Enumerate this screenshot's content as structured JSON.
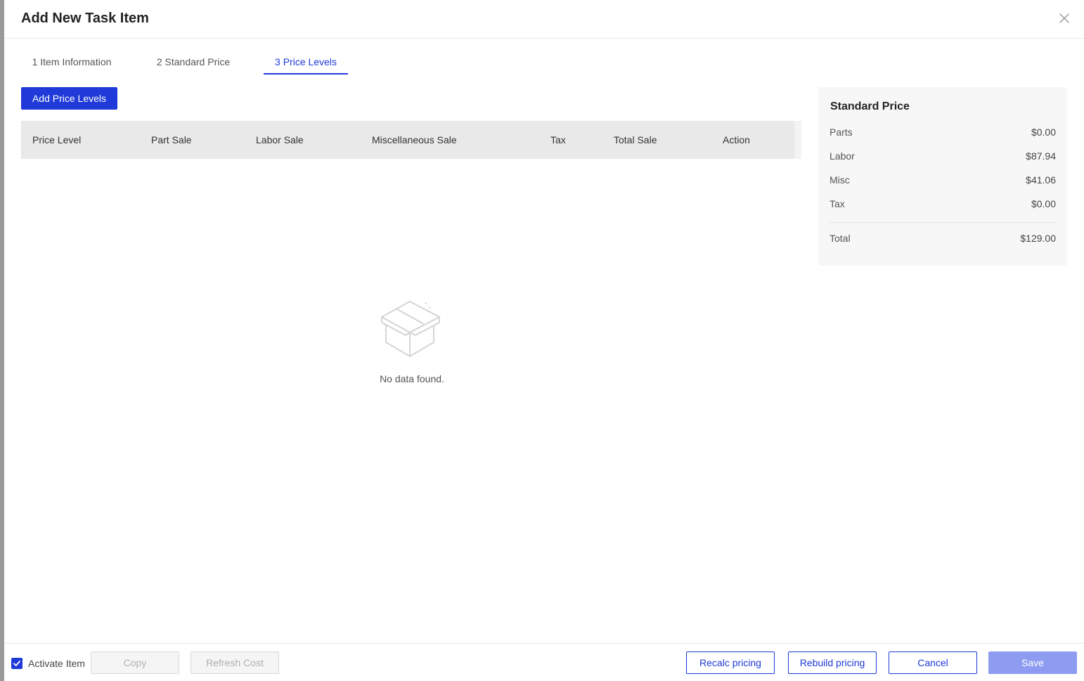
{
  "dialog": {
    "title": "Add New Task Item"
  },
  "steps": [
    {
      "label": "1 Item Information",
      "active": false
    },
    {
      "label": "2 Standard Price",
      "active": false
    },
    {
      "label": "3 Price Levels",
      "active": true
    }
  ],
  "toolbar": {
    "add_label": "Add Price Levels"
  },
  "table": {
    "columns": [
      "Price Level",
      "Part Sale",
      "Labor Sale",
      "Miscellaneous Sale",
      "Tax",
      "Total Sale",
      "Action"
    ],
    "rows": [],
    "empty_message": "No data found."
  },
  "summary": {
    "title": "Standard Price",
    "rows": [
      {
        "label": "Parts",
        "value": "$0.00"
      },
      {
        "label": "Labor",
        "value": "$87.94"
      },
      {
        "label": "Misc",
        "value": "$41.06"
      },
      {
        "label": "Tax",
        "value": "$0.00"
      }
    ],
    "total": {
      "label": "Total",
      "value": "$129.00"
    }
  },
  "footer": {
    "activate_label": "Activate Item",
    "activate_checked": true,
    "copy_label": "Copy",
    "refresh_cost_label": "Refresh Cost",
    "recalc_label": "Recalc pricing",
    "rebuild_label": "Rebuild pricing",
    "cancel_label": "Cancel",
    "save_label": "Save"
  },
  "colors": {
    "accent": "#1f3ad9",
    "save_disabled": "#8d9cf0",
    "table_header": "#e9e9e9",
    "summary_bg": "#f7f7f7"
  },
  "icons": {
    "close": "close-icon",
    "empty": "empty-box-icon",
    "checkbox": "check-icon"
  }
}
